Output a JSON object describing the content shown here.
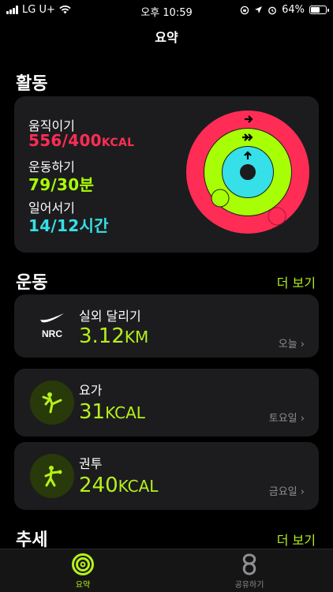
{
  "status_bar": {
    "carrier": "LG U+",
    "time": "오후 10:59",
    "battery": "64%",
    "battery_level": 0.64
  },
  "nav": {
    "title": "요약"
  },
  "activity": {
    "title": "활동",
    "move": {
      "label": "움직이기",
      "value": "556/400",
      "unit": "KCAL",
      "progress": 1.39,
      "color": "#ff2d55"
    },
    "exercise": {
      "label": "운동하기",
      "value": "79/30",
      "unit": "분",
      "progress": 2.63,
      "color": "#a8ff05"
    },
    "stand": {
      "label": "일어서기",
      "value": "14/12",
      "unit": "시간",
      "progress": 1.17,
      "color": "#35e0e8"
    }
  },
  "workouts": {
    "title": "운동",
    "more": "더 보기",
    "items": [
      {
        "name": "실외 달리기",
        "value": "3.12",
        "unit": "KM",
        "date": "오늘",
        "icon": "nrc-logo-icon",
        "icon_text": "NRC"
      },
      {
        "name": "요가",
        "value": "31",
        "unit": "KCAL",
        "date": "토요일",
        "icon": "yoga-figure-icon"
      },
      {
        "name": "권투",
        "value": "240",
        "unit": "KCAL",
        "date": "금요일",
        "icon": "boxing-figure-icon"
      }
    ]
  },
  "trends": {
    "title": "추세",
    "more": "더 보기"
  },
  "tabs": [
    {
      "label": "요약",
      "icon": "activity-rings-icon",
      "active": true
    },
    {
      "label": "공유하기",
      "icon": "sharing-icon",
      "active": false
    }
  ],
  "colors": {
    "accent": "#b6f11a",
    "move": "#ff2d55",
    "exercise": "#a8ff05",
    "stand": "#35e0e8"
  }
}
